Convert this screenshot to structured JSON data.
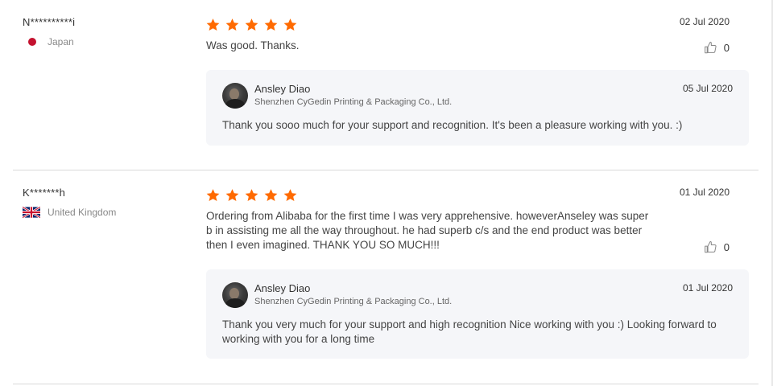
{
  "reviews": [
    {
      "buyer": "N**********i",
      "country": "Japan",
      "country_flag": "japan-flag",
      "rating": 5,
      "date": "02 Jul 2020",
      "text": "Was good. Thanks.",
      "likes": "0",
      "reply": {
        "name": "Ansley Diao",
        "company": "Shenzhen CyGedin Printing & Packaging Co., Ltd.",
        "date": "05 Jul 2020",
        "text": "Thank you sooo much for your support and recognition. It's been a pleasure working with you. :)"
      }
    },
    {
      "buyer": "K*******h",
      "country": "United Kingdom",
      "country_flag": "uk-flag",
      "rating": 5,
      "date": "01 Jul 2020",
      "text": "Ordering from Alibaba for the first time I was very apprehensive. howeverAnseley was super\nb in assisting me all the way throughout. he had superb c/s and the end product was better\n then I even imagined. THANK YOU SO MUCH!!!",
      "likes": "0",
      "reply": {
        "name": "Ansley Diao",
        "company": "Shenzhen CyGedin Printing & Packaging Co., Ltd.",
        "date": "01 Jul 2020",
        "text": "Thank you very much for your support and high recognition Nice working with you :) Looking forward to\n working with you for a long time"
      }
    }
  ],
  "colors": {
    "star": "#ff6a00",
    "reply_background": "#f5f6f9",
    "divider": "#d9d9d9",
    "japan_red": "#c4122f"
  }
}
